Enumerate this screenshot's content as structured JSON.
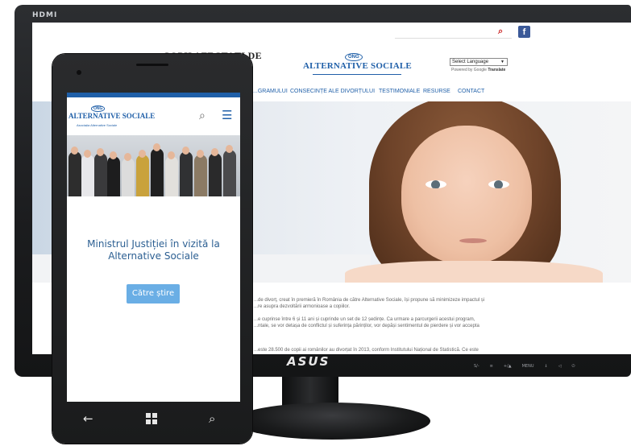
{
  "monitor": {
    "hdmi_label": "HDMI",
    "brand": "ASUS",
    "controls": [
      "S/-",
      "≡",
      "+/▲",
      "MENU",
      "⇓",
      "◁",
      "⏻"
    ]
  },
  "desktop_site": {
    "brand_title": "COPII AFECTAȚI DE",
    "logo": {
      "badge": "ONG",
      "word": "ALTERNATIVE SOCIALE"
    },
    "language_select": "Select Language",
    "powered_by": "Powered by",
    "powered_google": "Google",
    "powered_translate": "Translate",
    "nav": [
      "...GRAMULUI",
      "CONSECINȚE ALE DIVORȚULUI",
      "TESTIMONIALE",
      "RESURSE",
      "CONTACT"
    ],
    "body_lines": [
      "...de divorț, creat în premieră în România de către Alternative Sociale, își propune să minimizeze impactul și",
      "...re asupra dezvoltării armonioase a copiilor.",
      "...e cuprinse între 6 și 11 ani și cuprinde un set de 12 ședințe. Ca urmare a parcurgerii acestui program,",
      "...ntale, se vor detașa de conflictul și suferința părinților, vor depăși sentimentul de pierdere și vor accepta",
      "...este 28.500 de copii ai românilor au divorțat în 2013, conform Institutului Național de Statistică. Ce este"
    ]
  },
  "mobile_site": {
    "logo": {
      "badge": "ONG",
      "word": "ALTERNATIVE SOCIALE",
      "tagline": "Asociația Alternative Sociale"
    },
    "headline": "Ministrul Justiției în vizită la Alternative Sociale",
    "button": "Către știre"
  },
  "colors": {
    "brand_blue": "#1f5fa8",
    "button_blue": "#6aaee5",
    "search_red": "#cc2a2a",
    "facebook_blue": "#3b5998"
  }
}
